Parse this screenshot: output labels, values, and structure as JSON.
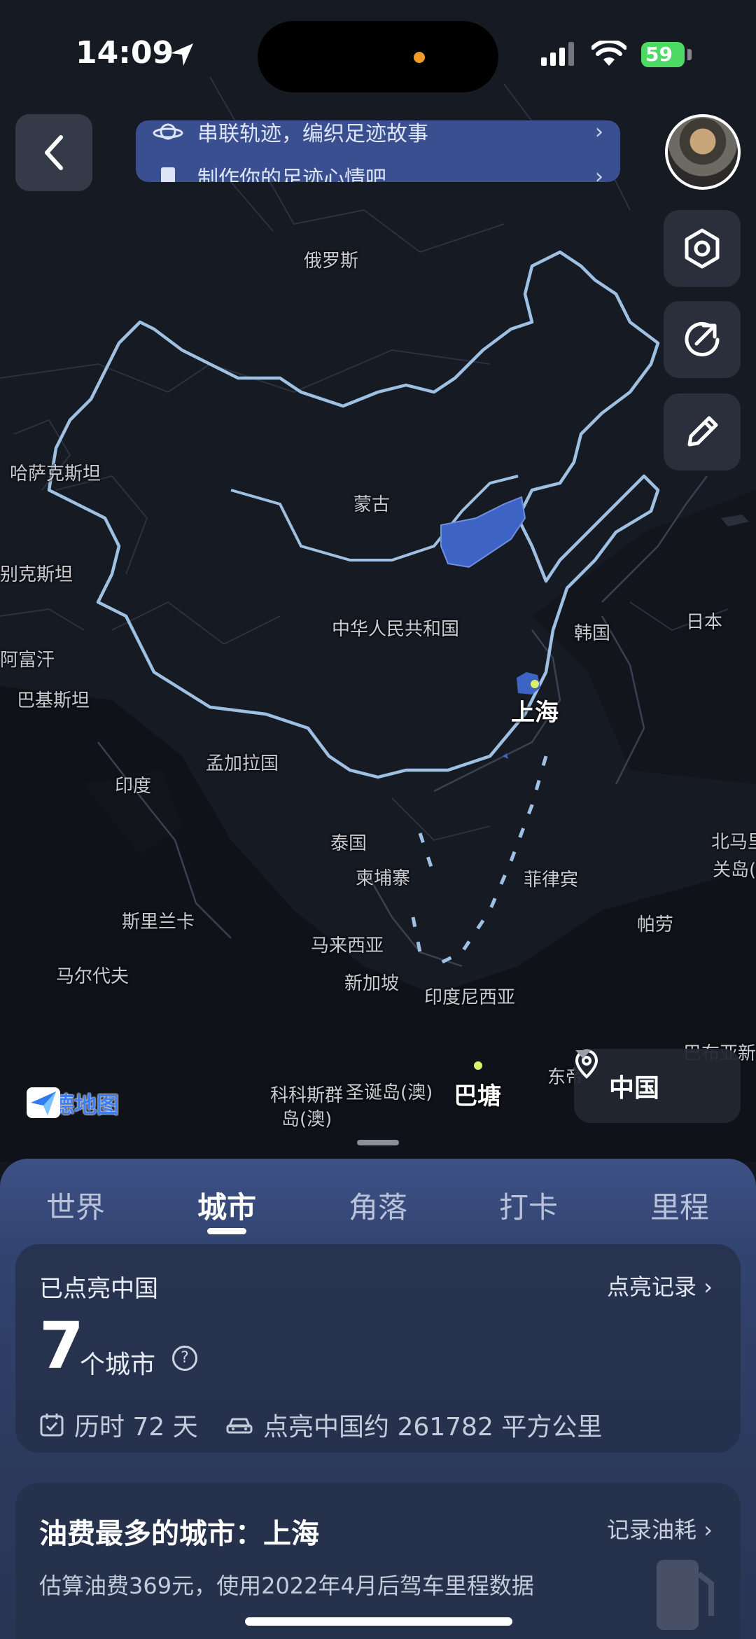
{
  "status_bar": {
    "time": "14:09",
    "battery": "59"
  },
  "banner": {
    "line1": "串联轨迹，编织足迹故事",
    "line2": "制作你的足迹心情吧"
  },
  "map": {
    "labels": [
      {
        "id": "russia",
        "text": "俄罗斯"
      },
      {
        "id": "kazakhstan",
        "text": "哈萨克斯坦"
      },
      {
        "id": "mongolia",
        "text": "蒙古"
      },
      {
        "id": "uzbekistan",
        "text": "别克斯坦"
      },
      {
        "id": "china",
        "text": "中华人民共和国"
      },
      {
        "id": "korea",
        "text": "韩国"
      },
      {
        "id": "japan",
        "text": "日本"
      },
      {
        "id": "afghanistan",
        "text": "阿富汗"
      },
      {
        "id": "pakistan",
        "text": "巴基斯坦"
      },
      {
        "id": "shanghai",
        "text": "上海"
      },
      {
        "id": "bangladesh",
        "text": "孟加拉国"
      },
      {
        "id": "india",
        "text": "印度"
      },
      {
        "id": "thailand",
        "text": "泰国"
      },
      {
        "id": "cambodia",
        "text": "柬埔寨"
      },
      {
        "id": "philippines",
        "text": "菲律宾"
      },
      {
        "id": "n_mariana_1",
        "text": "北马里"
      },
      {
        "id": "n_mariana_2",
        "text": "关岛(美"
      },
      {
        "id": "srilanka",
        "text": "斯里兰卡"
      },
      {
        "id": "palau",
        "text": "帕劳"
      },
      {
        "id": "malaysia",
        "text": "马来西亚"
      },
      {
        "id": "maldives",
        "text": "马尔代夫"
      },
      {
        "id": "singapore",
        "text": "新加坡"
      },
      {
        "id": "indonesia",
        "text": "印度尼西亚"
      },
      {
        "id": "png",
        "text": "巴布亚新"
      },
      {
        "id": "cocos1",
        "text": "科科斯群"
      },
      {
        "id": "cocos2",
        "text": "岛(澳)"
      },
      {
        "id": "christmas",
        "text": "圣诞岛(澳)"
      },
      {
        "id": "batang",
        "text": "巴塘"
      },
      {
        "id": "easttimor",
        "text": "东帝"
      }
    ],
    "logo_text": "高德地图",
    "region_selector": "中国"
  },
  "tabs": [
    "世界",
    "城市",
    "角落",
    "打卡",
    "里程"
  ],
  "active_tab": "城市",
  "summary_card": {
    "title": "已点亮中国",
    "link": "点亮记录",
    "count": "7",
    "count_unit": "个城市",
    "duration": "历时 72 天",
    "area": "点亮中国约 261782 平方公里"
  },
  "fuel_card": {
    "title": "油费最多的城市：上海",
    "link": "记录油耗",
    "desc": "估算油费369元，使用2022年4月后驾车里程数据"
  }
}
